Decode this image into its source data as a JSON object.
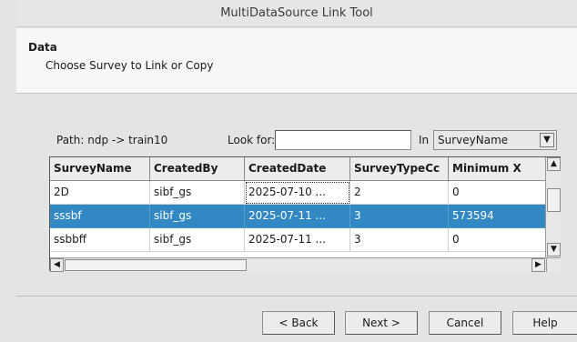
{
  "window": {
    "title": "MultiDataSource Link Tool"
  },
  "header": {
    "title": "Data",
    "subtitle": "Choose Survey to Link or Copy"
  },
  "filter": {
    "path_label": "Path: ndp -> train10",
    "look_for_label": "Look for:",
    "look_for_value": "",
    "in_label": "In",
    "in_value": "SurveyName"
  },
  "table": {
    "columns": [
      "SurveyName",
      "CreatedBy",
      "CreatedDate",
      "SurveyTypeCc",
      "Minimum X"
    ],
    "rows": [
      [
        "2D",
        "sibf_gs",
        "2025-07-10 ...",
        "2",
        "0"
      ],
      [
        "sssbf",
        "sibf_gs",
        "2025-07-11 ...",
        "3",
        "573594"
      ],
      [
        "ssbbff",
        "sibf_gs",
        "2025-07-11 ...",
        "3",
        "0"
      ]
    ],
    "selected_row": 1
  },
  "buttons": {
    "back": "< Back",
    "next": "Next >",
    "cancel": "Cancel",
    "help": "Help"
  }
}
